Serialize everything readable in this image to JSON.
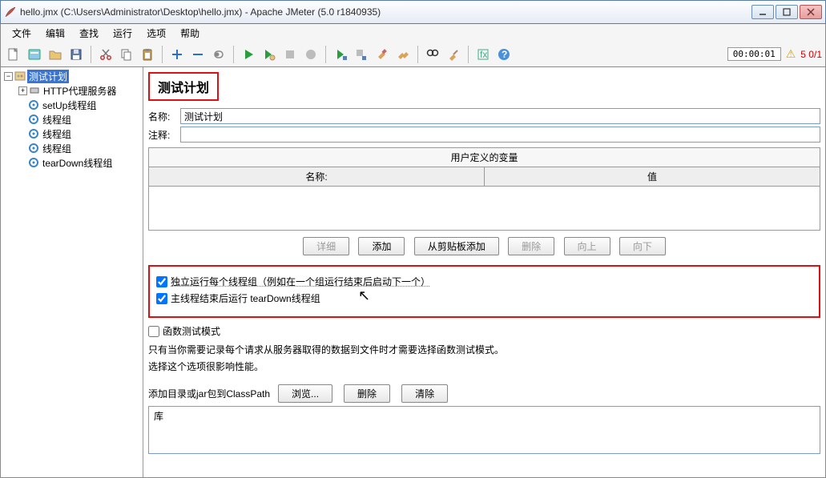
{
  "window": {
    "title": "hello.jmx (C:\\Users\\Administrator\\Desktop\\hello.jmx) - Apache JMeter (5.0 r1840935)"
  },
  "menu": {
    "file": "文件",
    "edit": "编辑",
    "search": "查找",
    "run": "运行",
    "options": "选项",
    "help": "帮助"
  },
  "status": {
    "timer": "00:00:01",
    "errors": "5 0/1"
  },
  "tree": {
    "root": "测试计划",
    "items": [
      "HTTP代理服务器",
      "setUp线程组",
      "线程组",
      "线程组",
      "线程组",
      "tearDown线程组"
    ]
  },
  "panel": {
    "title": "测试计划",
    "name_label": "名称:",
    "name_value": "测试计划",
    "comment_label": "注释:",
    "comment_value": ""
  },
  "vars": {
    "section_title": "用户定义的变量",
    "col_name": "名称:",
    "col_value": "值"
  },
  "buttons": {
    "detail": "详细",
    "add": "添加",
    "from_clip": "从剪贴板添加",
    "delete": "删除",
    "up": "向上",
    "down": "向下",
    "browse": "浏览...",
    "delete2": "删除",
    "clear": "清除"
  },
  "checks": {
    "serial": "独立运行每个线程组（例如在一个组运行结束后启动下一个）",
    "teardown": "主线程结束后运行 tearDown线程组",
    "functest": "函数测试模式"
  },
  "notes": {
    "line1": "只有当你需要记录每个请求从服务器取得的数据到文件时才需要选择函数测试模式。",
    "line2": "选择这个选项很影响性能。"
  },
  "classpath": {
    "label": "添加目录或jar包到ClassPath",
    "lib": "库"
  }
}
